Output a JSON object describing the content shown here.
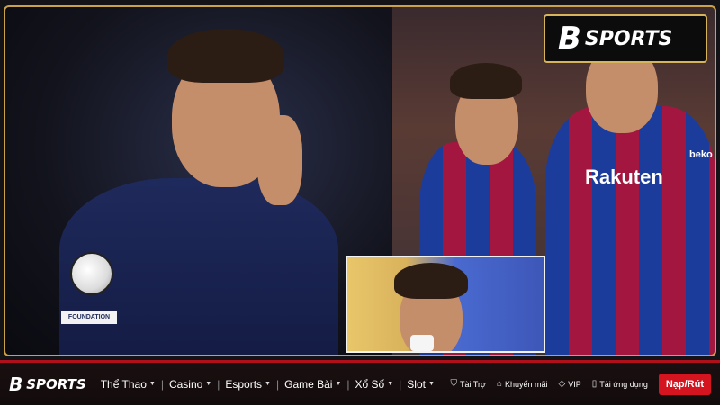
{
  "brand": {
    "logo_mark": "B",
    "logo_text": "SPORTS"
  },
  "photos": {
    "left_badge_text": "FOUNDATION",
    "right_shirt_text": "Rakuten",
    "right_sleeve_text": "beko"
  },
  "nav": {
    "items": [
      {
        "label": "Thể Thao",
        "icon": "chevron-down-icon"
      },
      {
        "label": "Casino",
        "icon": "chevron-down-icon"
      },
      {
        "label": "Esports",
        "icon": "chevron-down-icon"
      },
      {
        "label": "Game Bài",
        "icon": "chevron-down-icon"
      },
      {
        "label": "Xổ Số",
        "icon": "chevron-down-icon"
      },
      {
        "label": "Slot",
        "icon": "chevron-down-icon"
      }
    ],
    "utilities": [
      {
        "label": "Tài Trợ",
        "icon": "shield-icon"
      },
      {
        "label": "Khuyến mãi",
        "icon": "tag-icon"
      },
      {
        "label": "VIP",
        "icon": "diamond-icon"
      },
      {
        "label": "Tải ứng dụng",
        "icon": "phone-icon"
      }
    ],
    "cta_label": "Nạp/Rút"
  },
  "colors": {
    "accent_gold": "#c9a24a",
    "brand_red": "#d4141e"
  }
}
